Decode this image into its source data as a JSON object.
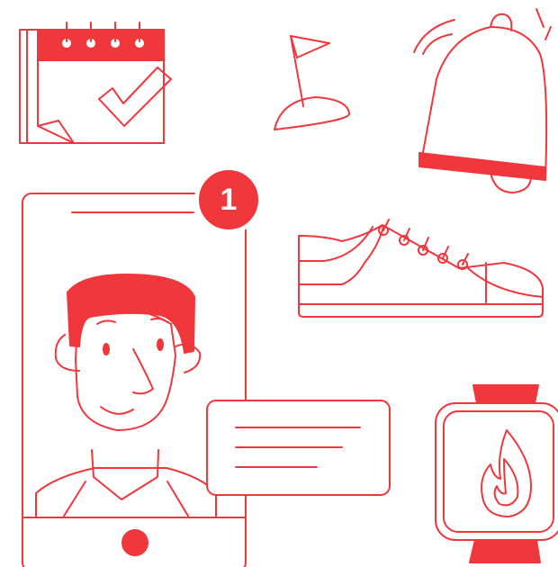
{
  "illustration": {
    "notification_badge": {
      "count": "1"
    }
  },
  "colors": {
    "stroke": "#f0373c",
    "fill": "#f0373c",
    "background": "#ffffff"
  },
  "icons": [
    "calendar-check-icon",
    "flag-icon",
    "bell-icon",
    "smartphone-icon",
    "notification-badge-icon",
    "man-avatar-icon",
    "chat-bubble-icon",
    "sneaker-icon",
    "smartwatch-fire-icon"
  ]
}
